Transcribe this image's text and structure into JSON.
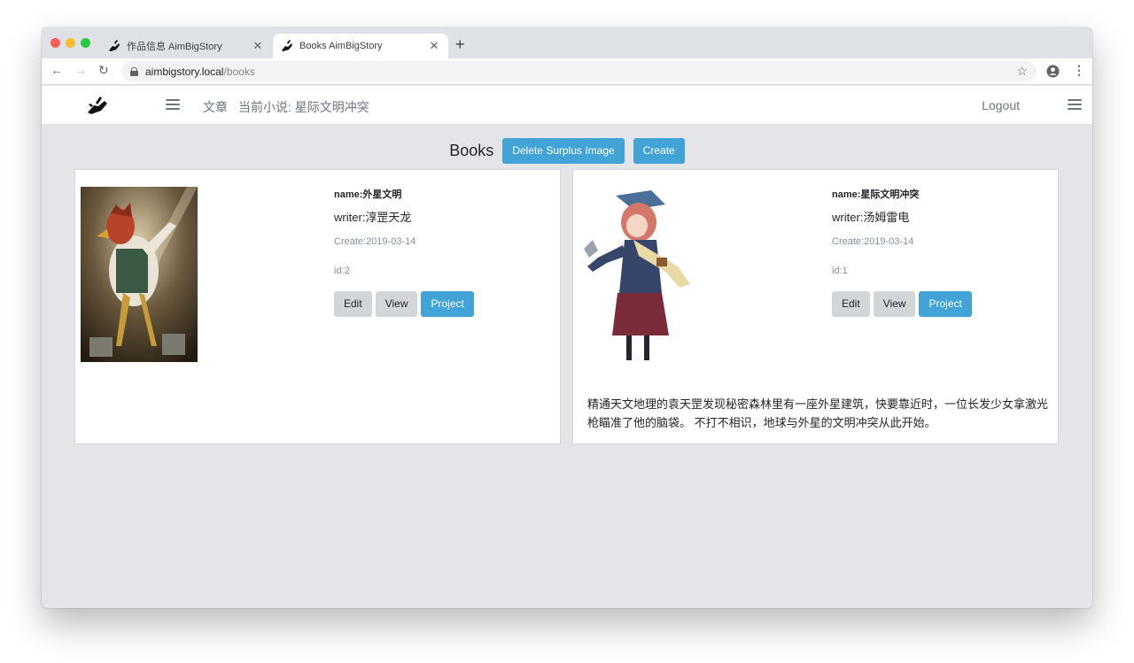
{
  "browser": {
    "tabs": [
      {
        "title": "作品信息 AimBigStory",
        "active": false
      },
      {
        "title": "Books AimBigStory",
        "active": true
      }
    ],
    "new_tab_label": "+",
    "close_label": "✕",
    "url_host": "aimbigstory.local",
    "url_path": "/books"
  },
  "navbar": {
    "links": [
      "文章",
      "当前小说: 星际文明冲突"
    ],
    "logout": "Logout"
  },
  "header": {
    "title": "Books",
    "delete_button": "Delete Surplus Image",
    "create_button": "Create"
  },
  "books": [
    {
      "name": "name:外星文明",
      "writer": "writer:淳罡天龙",
      "create": "Create:2019-03-14",
      "id": "id:2",
      "description": ""
    },
    {
      "name": "name:星际文明冲突",
      "writer": "writer:汤姆雷电",
      "create": "Create:2019-03-14",
      "id": "id:1",
      "description": "精通天文地理的袁天罡发现秘密森林里有一座外星建筑，快要靠近时，一位长发少女拿激光枪瞄准了他的脑袋。 不打不相识，地球与外星的文明冲突从此开始。"
    }
  ],
  "card_actions": {
    "edit": "Edit",
    "view": "View",
    "project": "Project"
  },
  "colors": {
    "accent": "#41a3d6",
    "page_bg": "#e4e5e8"
  }
}
